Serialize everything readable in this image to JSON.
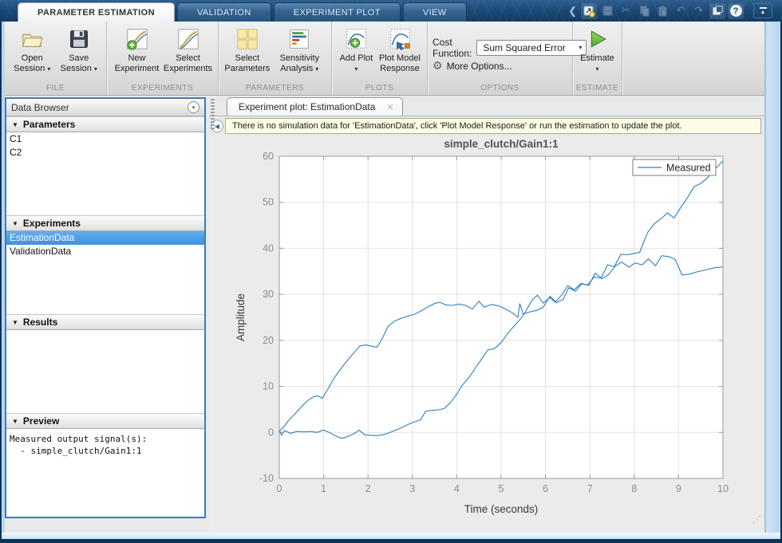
{
  "glyphs": {
    "dropdown": "▾",
    "section_collapse": "▼",
    "close": "✕",
    "help": "?",
    "back": "◀",
    "collapse_ribbon": "▲",
    "cut": "✂",
    "undo": "↶",
    "redo": "↷",
    "gear": "⚙",
    "resize_grip": "⋰",
    "qat_chevron": "❮"
  },
  "header": {
    "tabs": [
      {
        "label": "PARAMETER ESTIMATION",
        "active": true
      },
      {
        "label": "VALIDATION"
      },
      {
        "label": "EXPERIMENT PLOT"
      },
      {
        "label": "VIEW"
      }
    ]
  },
  "ribbon": {
    "file": {
      "group_label": "FILE",
      "open": {
        "line1": "Open",
        "line2": "Session"
      },
      "save": {
        "line1": "Save",
        "line2": "Session"
      }
    },
    "experiments": {
      "group_label": "EXPERIMENTS",
      "new": {
        "line1": "New",
        "line2": "Experiment"
      },
      "select": {
        "line1": "Select",
        "line2": "Experiments"
      }
    },
    "parameters": {
      "group_label": "PARAMETERS",
      "select": {
        "line1": "Select",
        "line2": "Parameters"
      },
      "sensitivity": {
        "line1": "Sensitivity",
        "line2": "Analysis"
      }
    },
    "plots": {
      "group_label": "PLOTS",
      "add": {
        "line1": "Add Plot"
      },
      "response": {
        "line1": "Plot Model",
        "line2": "Response"
      }
    },
    "options": {
      "group_label": "OPTIONS",
      "cost_function_label": "Cost Function:",
      "cost_function_value": "Sum Squared Error",
      "more_options": "More Options..."
    },
    "estimate": {
      "group_label": "ESTIMATE",
      "label": "Estimate"
    }
  },
  "sidebar": {
    "title": "Data Browser",
    "sections": {
      "parameters": {
        "label": "Parameters",
        "items": [
          "C1",
          "C2"
        ]
      },
      "experiments": {
        "label": "Experiments",
        "items": [
          {
            "label": "EstimationData",
            "selected": true
          },
          {
            "label": "ValidationData"
          }
        ]
      },
      "results": {
        "label": "Results",
        "items": []
      },
      "preview": {
        "label": "Preview",
        "text": "Measured output signal(s):\n  - simple_clutch/Gain1:1"
      }
    }
  },
  "main": {
    "doc_tab": "Experiment plot: EstimationData",
    "info_message": "There is no simulation data for 'EstimationData', click 'Plot Model Response' or run the estimation to update the plot."
  },
  "chart_data": {
    "type": "line",
    "title": "simple_clutch/Gain1:1",
    "xlabel": "Time (seconds)",
    "ylabel": "Amplitude",
    "xlim": [
      0,
      10
    ],
    "ylim": [
      -10,
      60
    ],
    "xticks": [
      0,
      1,
      2,
      3,
      4,
      5,
      6,
      7,
      8,
      9,
      10
    ],
    "yticks": [
      -10,
      0,
      10,
      20,
      30,
      40,
      50,
      60
    ],
    "grid": true,
    "legend": [
      "Measured"
    ],
    "legend_position": "top-right",
    "line_color": "#2e7fc1",
    "grid_color": "#e2e2e2",
    "axis_color": "#9a9a9a",
    "tick_color": "#8c8c8c",
    "title_color": "#525252",
    "label_color": "#3a3a3a",
    "series": [
      {
        "name": "Measured",
        "x": [
          0,
          0.1,
          0.2,
          0.35,
          0.5,
          0.65,
          0.78,
          0.88,
          0.97,
          1.1,
          1.25,
          1.4,
          1.55,
          1.7,
          1.82,
          1.95,
          2.1,
          2.2,
          2.3,
          2.45,
          2.6,
          2.75,
          2.9,
          3.05,
          3.2,
          3.35,
          3.5,
          3.62,
          3.75,
          3.9,
          4.05,
          4.2,
          4.35,
          4.5,
          4.62,
          4.78,
          4.95,
          5.1,
          5.25,
          5.38,
          5.42,
          5.5,
          5.65,
          5.8,
          5.95,
          6.1,
          6.25,
          6.4,
          6.52,
          6.68,
          6.82,
          6.98,
          7.12,
          7.28,
          7.42,
          7.58,
          7.72,
          7.88,
          8.02,
          8.18,
          8.32,
          8.48,
          8.62,
          8.78,
          8.92,
          9.08,
          9.25,
          9.42,
          9.6,
          9.78,
          10
        ],
        "y": [
          0.3,
          1.2,
          2.5,
          4,
          5.6,
          7,
          7.8,
          7.9,
          7.4,
          9.5,
          12,
          14,
          15.8,
          17.5,
          18.8,
          19,
          18.7,
          18.5,
          20,
          23,
          24.2,
          24.8,
          25.3,
          25.7,
          26.4,
          27.3,
          28,
          28.3,
          27.7,
          27.6,
          27.9,
          27.6,
          26.8,
          28.5,
          27.2,
          27.8,
          27.5,
          26.8,
          26,
          25,
          28,
          25.7,
          26.2,
          26.5,
          27.2,
          29.6,
          28.2,
          28.9,
          31.4,
          30.7,
          32.3,
          32,
          34.6,
          33.4,
          34.3,
          36.2,
          37,
          35.9,
          36.8,
          36.4,
          37.7,
          36.2,
          38.4,
          38.2,
          37.6,
          34.2,
          34.4,
          34.9,
          35.3,
          35.7,
          36
        ]
      },
      {
        "name": "Measured",
        "x": [
          0,
          0.05,
          0.12,
          0.25,
          0.4,
          0.55,
          0.7,
          0.85,
          1,
          1.12,
          1.28,
          1.4,
          1.55,
          1.7,
          1.8,
          1.92,
          2,
          2.15,
          2.3,
          2.45,
          2.6,
          2.75,
          2.9,
          3.05,
          3.18,
          3.3,
          3.45,
          3.6,
          3.72,
          3.85,
          4,
          4.12,
          4.28,
          4.42,
          4.58,
          4.7,
          4.85,
          5,
          5.15,
          5.3,
          5.45,
          5.55,
          5.7,
          5.82,
          5.95,
          6.1,
          6.22,
          6.38,
          6.5,
          6.65,
          6.8,
          6.95,
          7.1,
          7.25,
          7.4,
          7.55,
          7.7,
          7.85,
          8,
          8.12,
          8.3,
          8.45,
          8.6,
          8.75,
          8.9,
          9.05,
          9.2,
          9.35,
          9.5,
          9.65,
          9.8,
          10
        ],
        "y": [
          0.5,
          -0.6,
          0.4,
          -0.2,
          0.2,
          0.1,
          0.2,
          0,
          0.5,
          0,
          -0.8,
          -1.3,
          -0.9,
          -0.2,
          0.5,
          -0.5,
          -0.6,
          -0.7,
          -0.6,
          -0.2,
          0.4,
          1,
          1.7,
          2.3,
          2.7,
          4.6,
          4.8,
          4.9,
          5.2,
          6.4,
          8.3,
          10.2,
          12,
          14,
          16.2,
          17.9,
          18.2,
          19.5,
          21.5,
          23.2,
          24.8,
          26.2,
          28.8,
          29.8,
          28.1,
          29.3,
          28.3,
          30,
          31.9,
          31,
          32.4,
          32,
          33.8,
          33.5,
          36.4,
          36,
          38.7,
          38.6,
          38.9,
          39.1,
          43.4,
          45.3,
          46.4,
          47.7,
          46.6,
          48.9,
          51,
          53.4,
          54.1,
          55.3,
          57,
          59
        ]
      }
    ]
  }
}
